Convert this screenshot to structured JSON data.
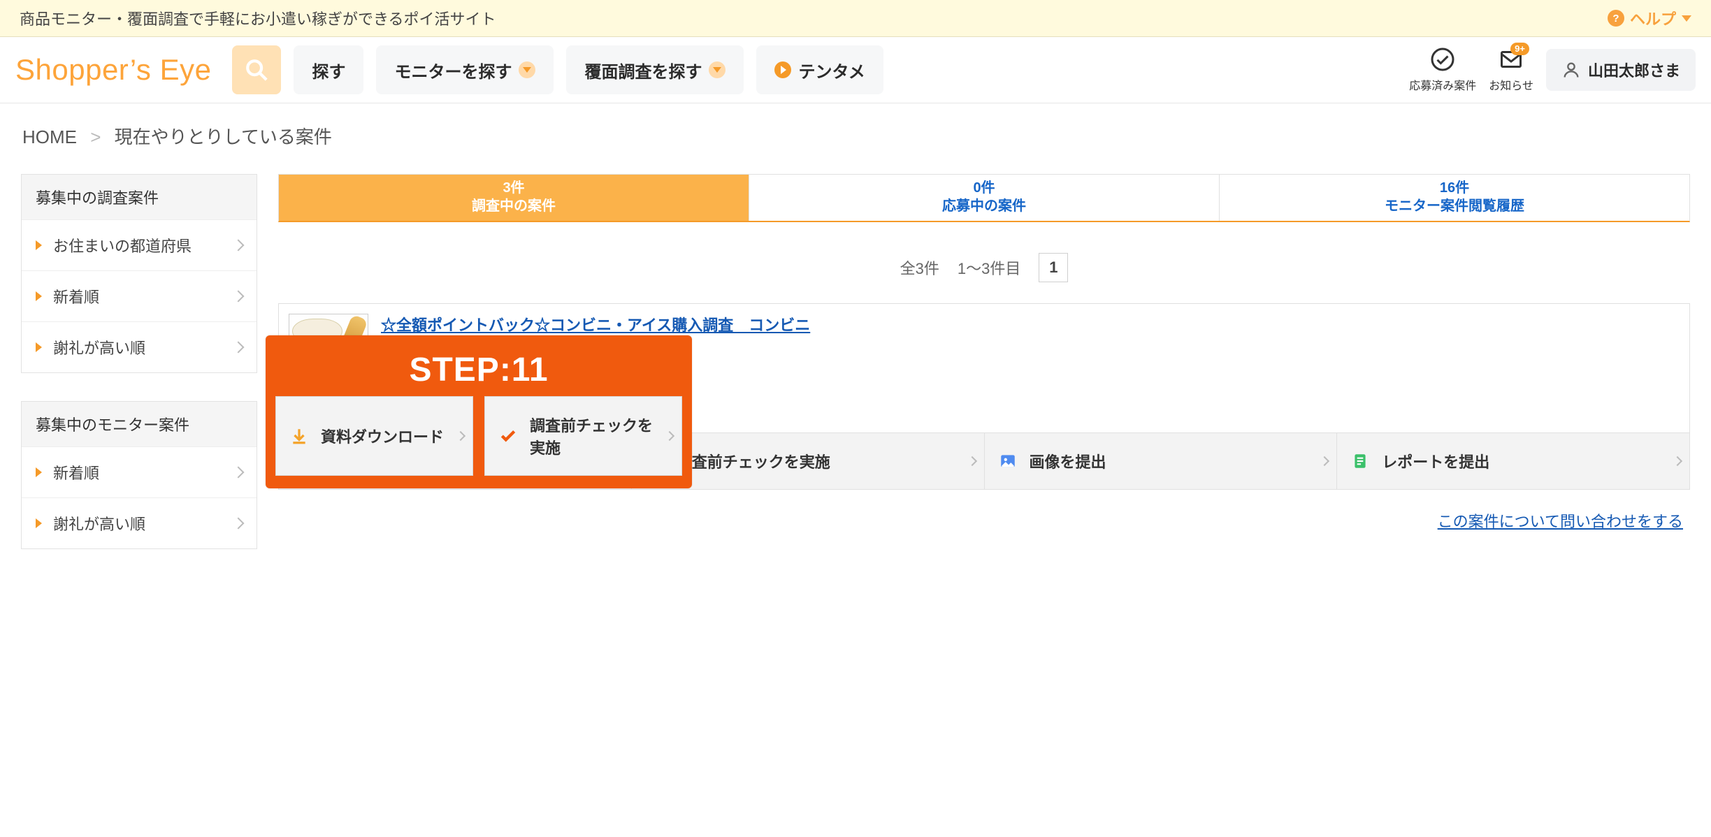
{
  "banner": {
    "tagline": "商品モニター・覆面調査で手軽にお小遣い稼ぎができるポイ活サイト",
    "help_label": "ヘルプ"
  },
  "header": {
    "logo": "Shopper’s Eye",
    "search_label": "探す",
    "nav1": "モニターを探す",
    "nav2": "覆面調査を探す",
    "nav3": "テンタメ",
    "applied_label": "応募済み案件",
    "notify_label": "お知らせ",
    "notify_badge": "9+",
    "user_name": "山田太郎さま"
  },
  "breadcrumb": {
    "home": "HOME",
    "current": "現在やりとりしている案件"
  },
  "sidebar": {
    "block1_title": "募集中の調査案件",
    "block1_items": [
      "お住まいの都道府県",
      "新着順",
      "謝礼が高い順"
    ],
    "block2_title": "募集中のモニター案件",
    "block2_items": [
      "新着順",
      "謝礼が高い順"
    ]
  },
  "tabs": [
    {
      "count": "3件",
      "label": "調査中の案件",
      "active": true
    },
    {
      "count": "0件",
      "label": "応募中の案件",
      "active": false
    },
    {
      "count": "16件",
      "label": "モニター案件閲覧履歴",
      "active": false
    }
  ],
  "pager": {
    "total": "全3件",
    "range": "1〜3件目",
    "page": "1"
  },
  "card": {
    "title": "☆全額ポイントバック☆コンビニ・アイス購入調査　コンビニ",
    "steps": [
      "資料ダウンロード",
      "調査前チェックを実施",
      "画像を提出",
      "レポートを提出"
    ],
    "inquiry": "この案件について問い合わせをする"
  },
  "overlay": {
    "label": "STEP:11"
  }
}
